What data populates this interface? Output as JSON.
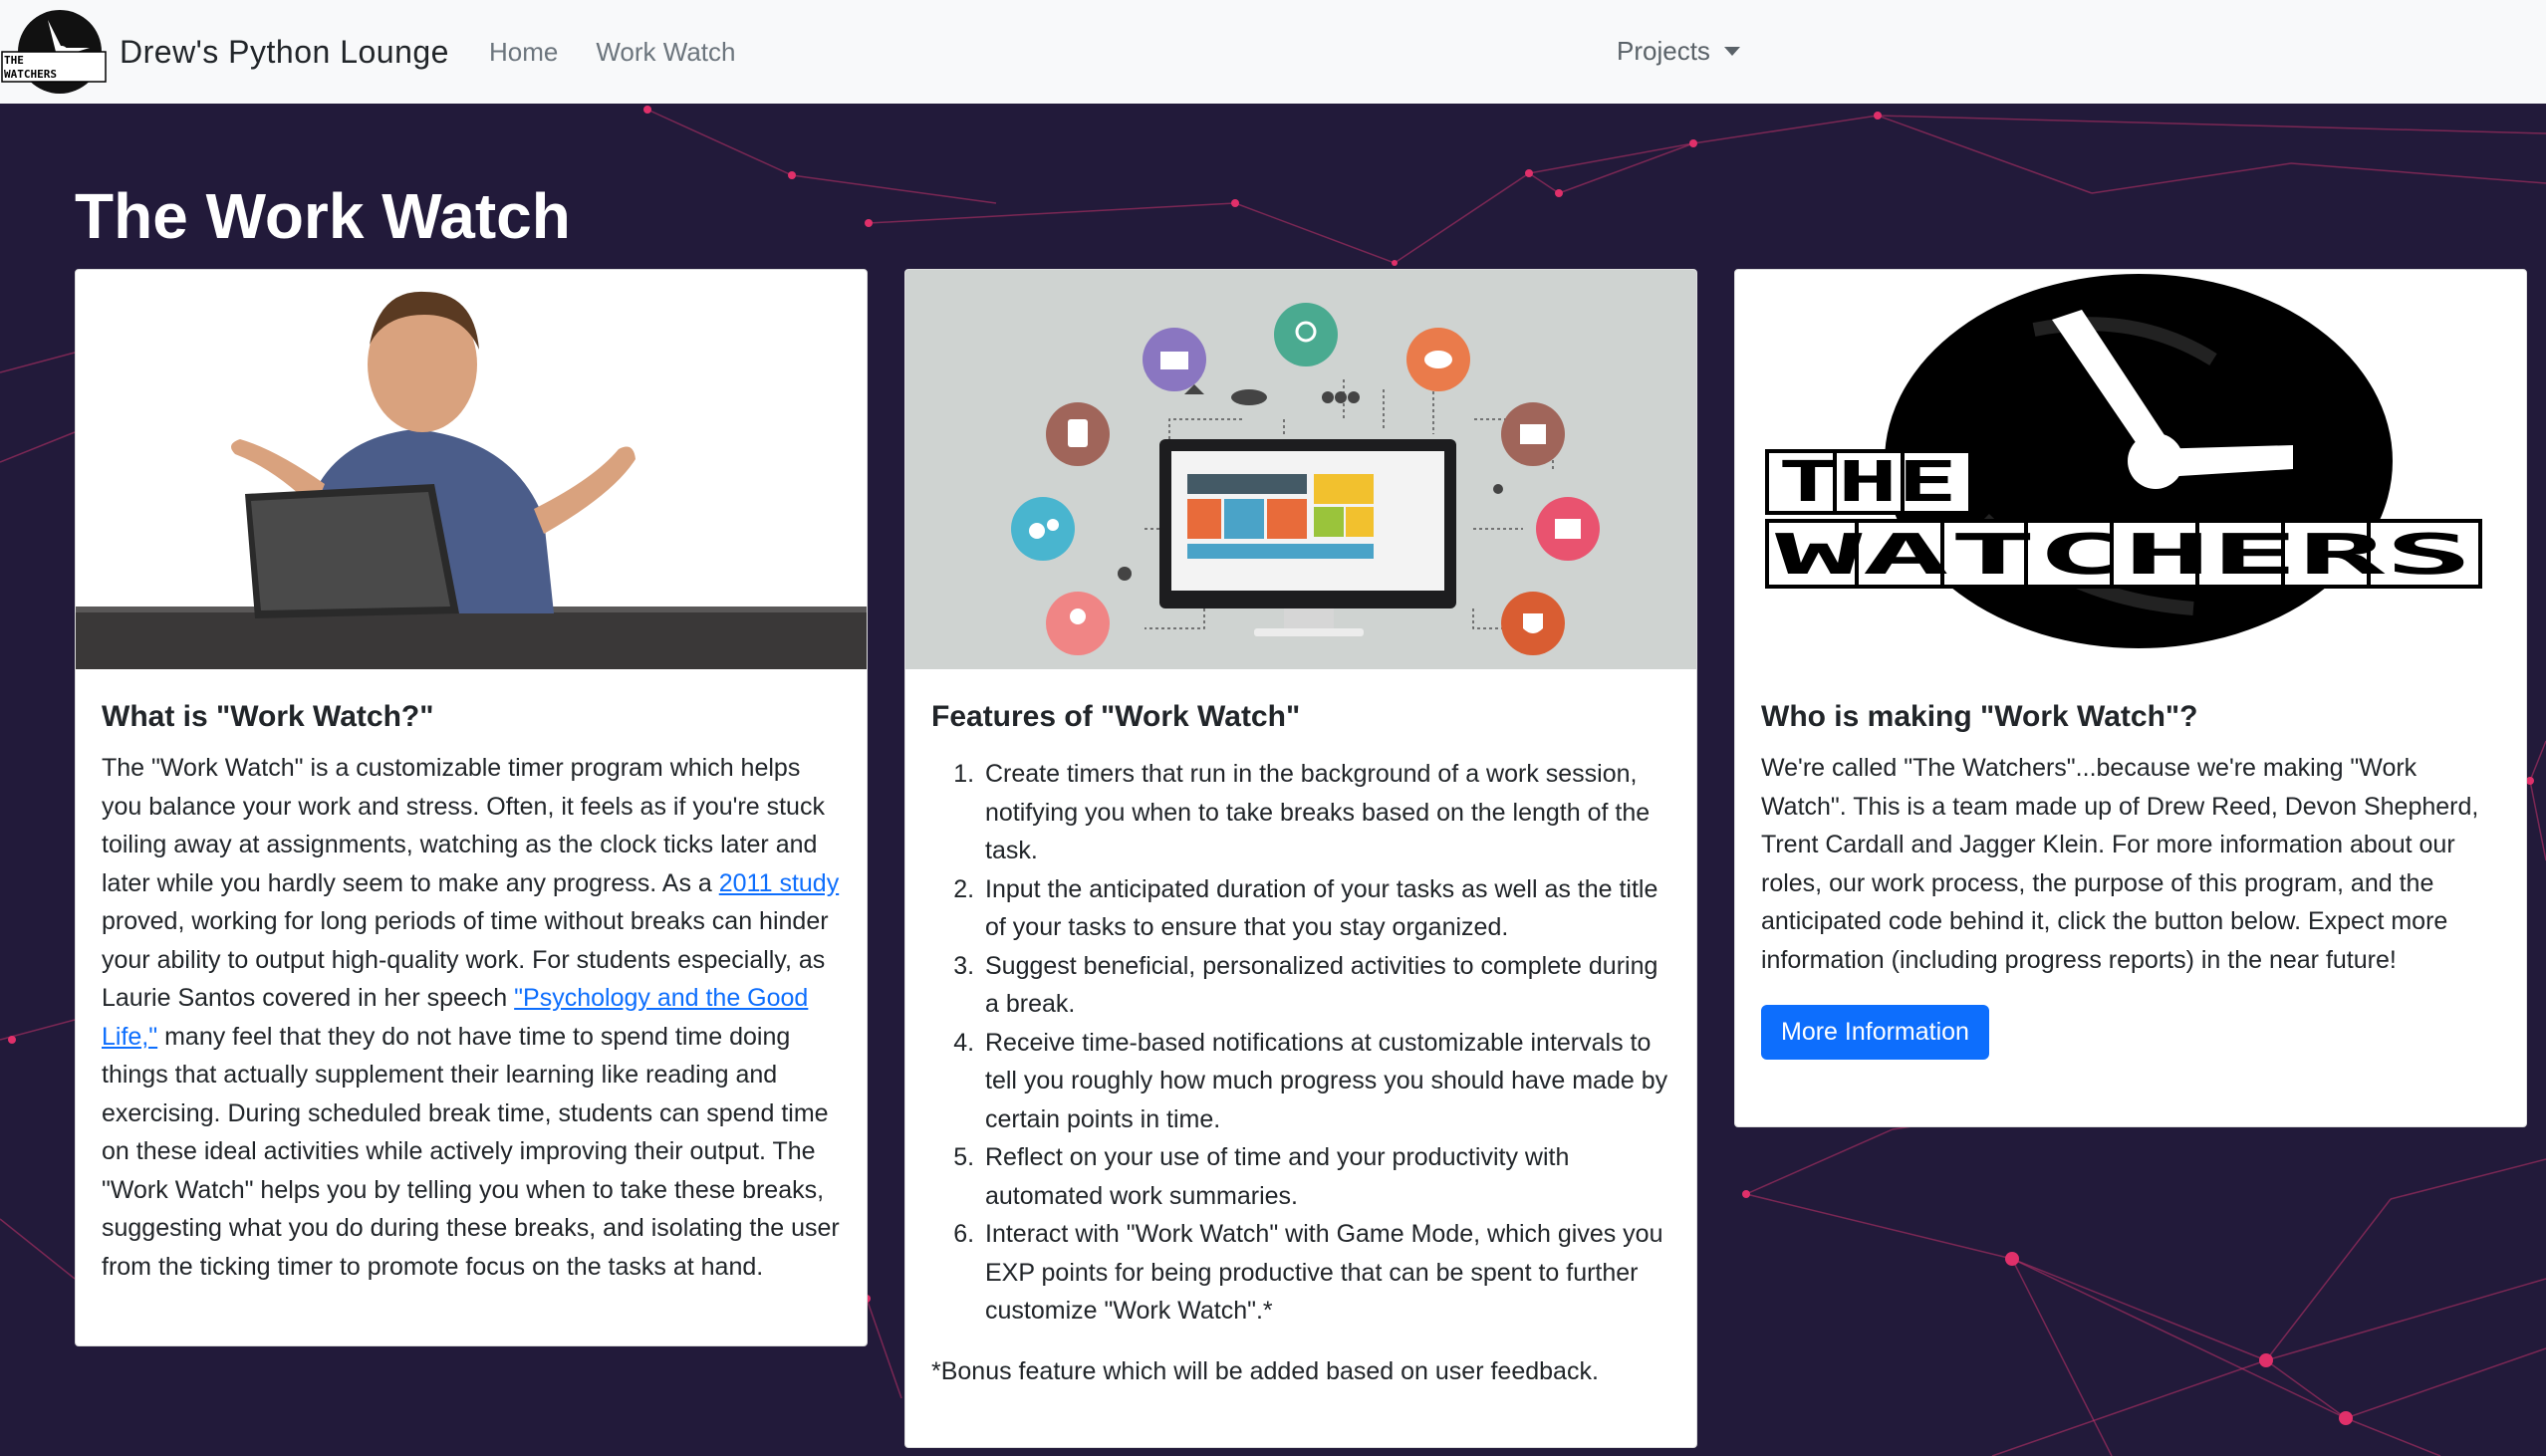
{
  "navbar": {
    "logo_text_top": "THE",
    "logo_text_bottom": "WATCHERS",
    "brand": "Drew's Python Lounge",
    "links": [
      "Home",
      "Work Watch"
    ],
    "dropdown": "Projects"
  },
  "page": {
    "title": "The Work Watch"
  },
  "card1": {
    "title": "What is \"Work Watch?\"",
    "text_1": "The \"Work Watch\" is a customizable timer program which helps you balance your work and stress. Often, it feels as if you're stuck toiling away at assignments, watching as the clock ticks later and later while you hardly seem to make any progress. As a ",
    "link_1": "2011 study",
    "text_2": " proved, working for long periods of time without breaks can hinder your ability to output high-quality work. For students especially, as Laurie Santos covered in her speech ",
    "link_2": "\"Psychology and the Good Life,\"",
    "text_3": " many feel that they do not have time to spend time doing things that actually supplement their learning like reading and exercising. During scheduled break time, students can spend time on these ideal activities while actively improving their output. The \"Work Watch\" helps you by telling you when to take these breaks, suggesting what you do during these breaks, and isolating the user from the ticking timer to promote focus on the tasks at hand."
  },
  "card2": {
    "title": "Features of \"Work Watch\"",
    "features": [
      "Create timers that run in the background of a work session, notifying you when to take breaks based on the length of the task.",
      "Input the anticipated duration of your tasks as well as the title of your tasks to ensure that you stay organized.",
      "Suggest beneficial, personalized activities to complete during a break.",
      "Receive time-based notifications at customizable intervals to tell you roughly how much progress you should have made by certain points in time.",
      "Reflect on your use of time and your productivity with automated work summaries.",
      "Interact with \"Work Watch\" with Game Mode, which gives you EXP points for being productive that can be spent to further customize \"Work Watch\".*"
    ],
    "footnote": "*Bonus feature which will be added based on user feedback."
  },
  "card3": {
    "logo_text_top": "THE",
    "logo_text_bottom": "WATCHERS",
    "title": "Who is making \"Work Watch\"?",
    "text": "We're called \"The Watchers\"...because we're making \"Work Watch\". This is a team made up of Drew Reed, Devon Shepherd, Trent Cardall and Jagger Klein. For more information about our roles, our work process, the purpose of this program, and the anticipated code behind it, click the button below. Expect more information (including progress reports) in the near future!",
    "button": "More Information"
  },
  "colors": {
    "background": "#221a3a",
    "network": "#d63a6a",
    "primary": "#0d6efd",
    "navbar": "#f8f9fa"
  }
}
